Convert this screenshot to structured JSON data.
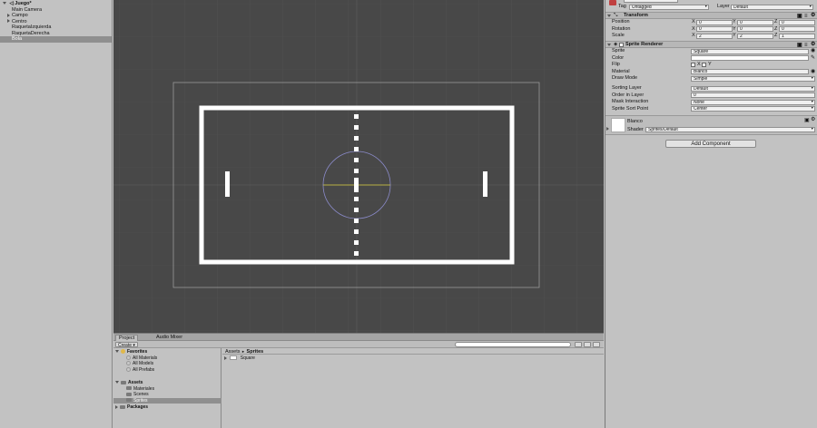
{
  "hierarchy": {
    "scene_name": "Juego*",
    "items": [
      {
        "label": "Main Camera"
      },
      {
        "label": "Campo"
      },
      {
        "label": "Centro"
      },
      {
        "label": "RaquetaIzquierda"
      },
      {
        "label": "RaquetaDerecha"
      },
      {
        "label": "Bola"
      }
    ]
  },
  "project": {
    "tabs": [
      "Project",
      "Audio Mixer"
    ],
    "create_label": "Create ▾",
    "favorites_label": "Favorites",
    "favorites": [
      "All Materials",
      "All Models",
      "All Prefabs"
    ],
    "assets_label": "Assets",
    "assets": [
      "Materiales",
      "Scenes",
      "Sprites"
    ],
    "packages_label": "Packages",
    "breadcrumb": {
      "root": "Assets",
      "sep": "►",
      "current": "Sprites"
    },
    "grid_items": [
      "Square"
    ]
  },
  "inspector": {
    "tag_label": "Tag",
    "tag_value": "Untagged",
    "layer_label": "Layer",
    "layer_value": "Default",
    "transform": {
      "title": "Transform",
      "position_label": "Position",
      "position": {
        "x": "0",
        "y": "0",
        "z": "0"
      },
      "rotation_label": "Rotation",
      "rotation": {
        "x": "0",
        "y": "0",
        "z": "0"
      },
      "scale_label": "Scale",
      "scale": {
        "x": "2",
        "y": "2",
        "z": "1"
      }
    },
    "sprite_renderer": {
      "title": "Sprite Renderer",
      "sprite_label": "Sprite",
      "sprite_value": "Square",
      "color_label": "Color",
      "flip_label": "Flip",
      "flip_x": "X",
      "flip_y": "Y",
      "material_label": "Material",
      "material_value": "Blanco",
      "draw_mode_label": "Draw Mode",
      "draw_mode_value": "Simple",
      "sorting_layer_label": "Sorting Layer",
      "sorting_layer_value": "Default",
      "order_label": "Order in Layer",
      "order_value": "0",
      "mask_label": "Mask Interaction",
      "mask_value": "None",
      "sort_point_label": "Sprite Sort Point",
      "sort_point_value": "Center"
    },
    "material": {
      "name": "Blanco",
      "shader_label": "Shader",
      "shader_value": "Sprites/Default"
    },
    "add_component_label": "Add Component",
    "axis_labels": {
      "x": "X",
      "y": "Y",
      "z": "Z"
    }
  },
  "colors": {
    "scene_bg": "#484848",
    "field_lines": "#ffffff",
    "selection": "#8f8f8f",
    "circle": "#8a8ac8",
    "axis_line": "#d8d040"
  }
}
